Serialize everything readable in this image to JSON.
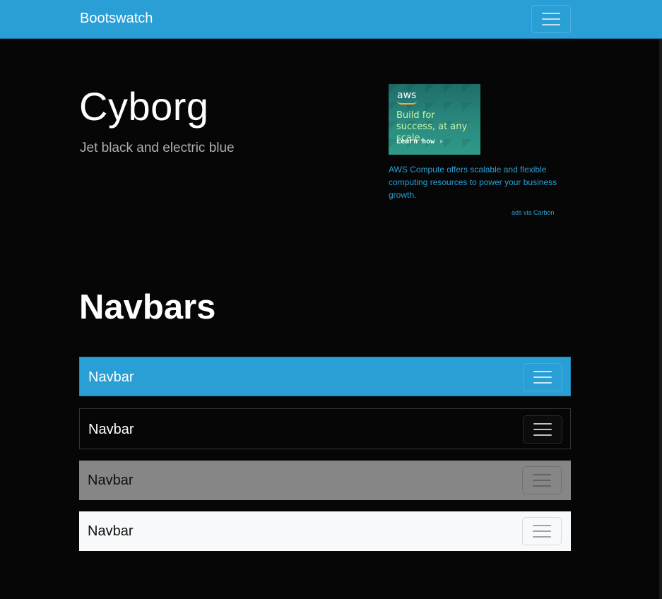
{
  "topbar": {
    "brand": "Bootswatch",
    "toggler_icon": "hamburger-icon",
    "background": "#2a9fd6"
  },
  "hero": {
    "title": "Cyborg",
    "subtitle": "Jet black and electric blue"
  },
  "ad": {
    "image_logo": "aws",
    "image_headline": "Build for success, at any scale.",
    "image_cta": "Learn how ›",
    "text": "AWS Compute offers scalable and flexible computing resources to power your business growth.",
    "via": "ads via Carbon"
  },
  "section": {
    "title": "Navbars"
  },
  "navbars": [
    {
      "brand": "Navbar",
      "variant": "primary",
      "background": "#2a9fd6"
    },
    {
      "brand": "Navbar",
      "variant": "dark",
      "background": "#060606"
    },
    {
      "brand": "Navbar",
      "variant": "secondary",
      "background": "#868686"
    },
    {
      "brand": "Navbar",
      "variant": "light",
      "background": "#f8f9fa"
    }
  ]
}
